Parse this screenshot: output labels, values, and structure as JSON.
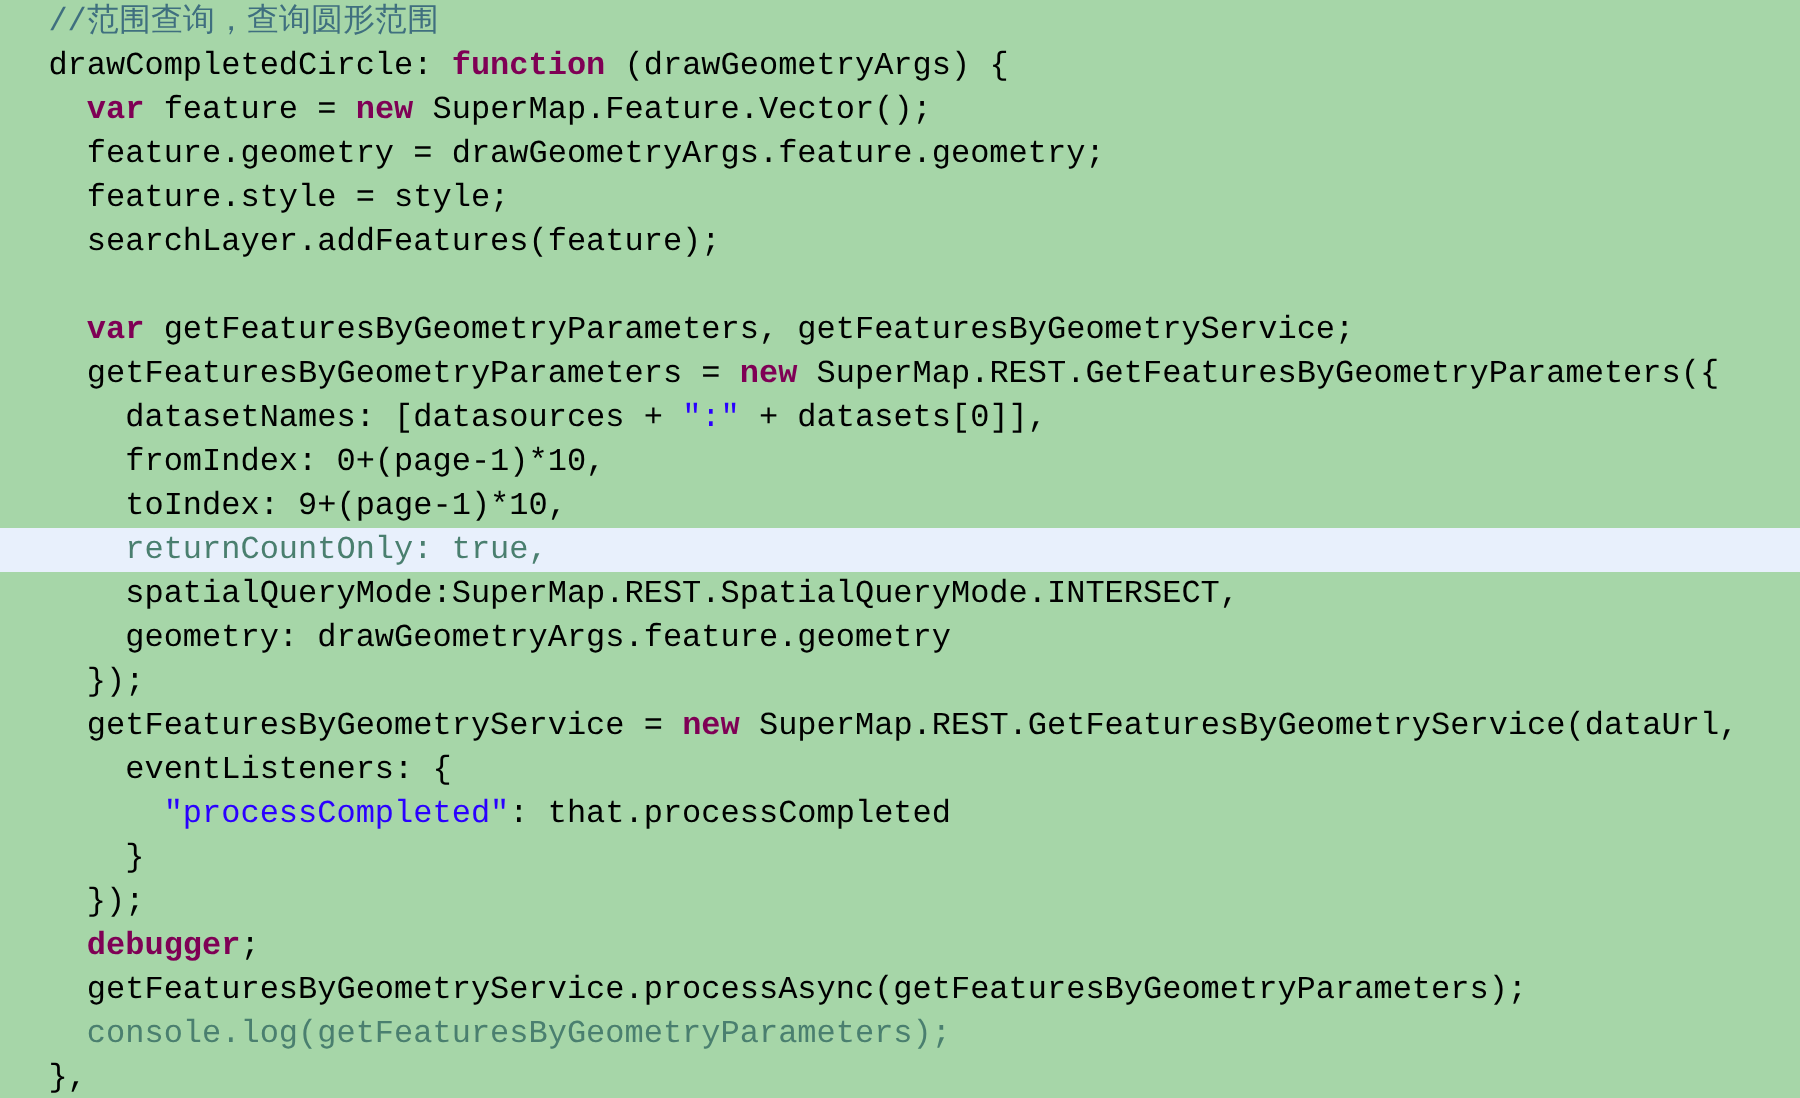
{
  "editor": {
    "lines": [
      {
        "current": false,
        "segments": [
          {
            "kind": "comment",
            "text": "  //范围查询，查询圆形范围"
          }
        ]
      },
      {
        "current": false,
        "segments": [
          {
            "kind": "plain",
            "text": "  drawCompletedCircle: "
          },
          {
            "kind": "keyword",
            "text": "function"
          },
          {
            "kind": "plain",
            "text": " (drawGeometryArgs) {"
          }
        ]
      },
      {
        "current": false,
        "segments": [
          {
            "kind": "keyword",
            "text": "    var"
          },
          {
            "kind": "plain",
            "text": " feature = "
          },
          {
            "kind": "keyword",
            "text": "new"
          },
          {
            "kind": "plain",
            "text": " SuperMap.Feature.Vector();"
          }
        ]
      },
      {
        "current": false,
        "segments": [
          {
            "kind": "plain",
            "text": "    feature.geometry = drawGeometryArgs.feature.geometry;"
          }
        ]
      },
      {
        "current": false,
        "segments": [
          {
            "kind": "plain",
            "text": "    feature.style = style;"
          }
        ]
      },
      {
        "current": false,
        "segments": [
          {
            "kind": "plain",
            "text": "    searchLayer.addFeatures(feature);"
          }
        ]
      },
      {
        "current": false
      },
      {
        "current": false,
        "segments": [
          {
            "kind": "keyword",
            "text": "    var"
          },
          {
            "kind": "plain",
            "text": " getFeaturesByGeometryParameters, getFeaturesByGeometryService;"
          }
        ]
      },
      {
        "current": false,
        "segments": [
          {
            "kind": "plain",
            "text": "    getFeaturesByGeometryParameters = "
          },
          {
            "kind": "keyword",
            "text": "new"
          },
          {
            "kind": "plain",
            "text": " SuperMap.REST.GetFeaturesByGeometryParameters({"
          }
        ]
      },
      {
        "current": false,
        "segments": [
          {
            "kind": "plain",
            "text": "      datasetNames: [datasources + "
          },
          {
            "kind": "string",
            "text": "\":\""
          },
          {
            "kind": "plain",
            "text": " + datasets[0]],"
          }
        ]
      },
      {
        "current": false,
        "segments": [
          {
            "kind": "plain",
            "text": "      fromIndex: 0+(page-1)*10,"
          }
        ]
      },
      {
        "current": false,
        "segments": [
          {
            "kind": "plain",
            "text": "      toIndex: 9+(page-1)*10,"
          }
        ]
      },
      {
        "current": true,
        "segments": [
          {
            "kind": "dim",
            "text": "      returnCountOnly: true,"
          }
        ]
      },
      {
        "current": false,
        "segments": [
          {
            "kind": "plain",
            "text": "      spatialQueryMode:SuperMap.REST.SpatialQueryMode.INTERSECT,"
          }
        ]
      },
      {
        "current": false,
        "segments": [
          {
            "kind": "plain",
            "text": "      geometry: drawGeometryArgs.feature.geometry"
          }
        ]
      },
      {
        "current": false,
        "segments": [
          {
            "kind": "plain",
            "text": "    });"
          }
        ]
      },
      {
        "current": false,
        "segments": [
          {
            "kind": "plain",
            "text": "    getFeaturesByGeometryService = "
          },
          {
            "kind": "keyword",
            "text": "new"
          },
          {
            "kind": "plain",
            "text": " SuperMap.REST.GetFeaturesByGeometryService(dataUrl,"
          }
        ]
      },
      {
        "current": false,
        "segments": [
          {
            "kind": "plain",
            "text": "      eventListeners: {"
          }
        ]
      },
      {
        "current": false,
        "segments": [
          {
            "kind": "string",
            "text": "        \"processCompleted\""
          },
          {
            "kind": "plain",
            "text": ": that.processCompleted"
          }
        ]
      },
      {
        "current": false,
        "segments": [
          {
            "kind": "plain",
            "text": "      }"
          }
        ]
      },
      {
        "current": false,
        "segments": [
          {
            "kind": "plain",
            "text": "    });"
          }
        ]
      },
      {
        "current": false,
        "segments": [
          {
            "kind": "keyword",
            "text": "    debugger"
          },
          {
            "kind": "plain",
            "text": ";"
          }
        ]
      },
      {
        "current": false,
        "segments": [
          {
            "kind": "plain",
            "text": "    getFeaturesByGeometryService.processAsync(getFeaturesByGeometryParameters);"
          }
        ]
      },
      {
        "current": false,
        "segments": [
          {
            "kind": "dim",
            "text": "    console.log(getFeaturesByGeometryParameters);"
          }
        ]
      },
      {
        "current": false,
        "segments": [
          {
            "kind": "plain",
            "text": "  },"
          }
        ]
      }
    ]
  }
}
